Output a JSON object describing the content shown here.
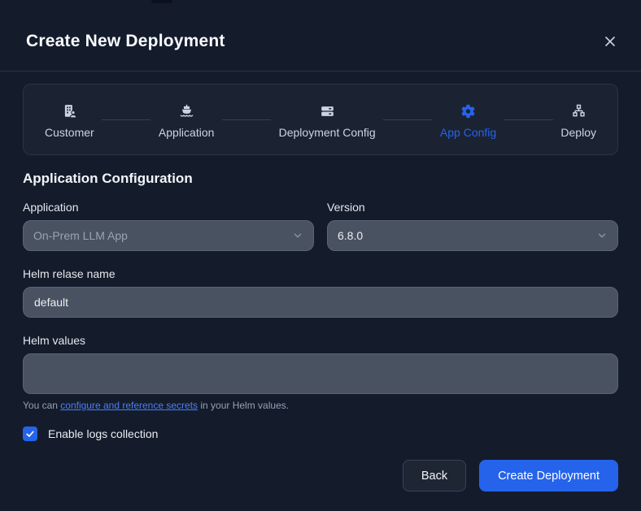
{
  "modal": {
    "title": "Create New Deployment"
  },
  "stepper": {
    "steps": [
      {
        "label": "Customer",
        "icon": "building-user-icon",
        "active": false
      },
      {
        "label": "Application",
        "icon": "ship-icon",
        "active": false
      },
      {
        "label": "Deployment Config",
        "icon": "server-icon",
        "active": false
      },
      {
        "label": "App Config",
        "icon": "gear-icon",
        "active": true
      },
      {
        "label": "Deploy",
        "icon": "sitemap-icon",
        "active": false
      }
    ]
  },
  "section": {
    "title": "Application Configuration"
  },
  "form": {
    "application": {
      "label": "Application",
      "value": "On-Prem LLM App",
      "disabled": true
    },
    "version": {
      "label": "Version",
      "value": "6.8.0"
    },
    "helm_release": {
      "label": "Helm relase name",
      "value": "default"
    },
    "helm_values": {
      "label": "Helm values",
      "value": ""
    },
    "helper": {
      "prefix": "You can ",
      "link": "configure and reference secrets",
      "suffix": " in your Helm values."
    },
    "logs_checkbox": {
      "label": "Enable logs collection",
      "checked": true
    }
  },
  "footer": {
    "back_label": "Back",
    "create_label": "Create Deployment"
  },
  "colors": {
    "accent": "#2563eb",
    "background": "#141c2c",
    "panel": "#1b2333",
    "input_bg": "#495261",
    "link": "#4c7ef3"
  }
}
